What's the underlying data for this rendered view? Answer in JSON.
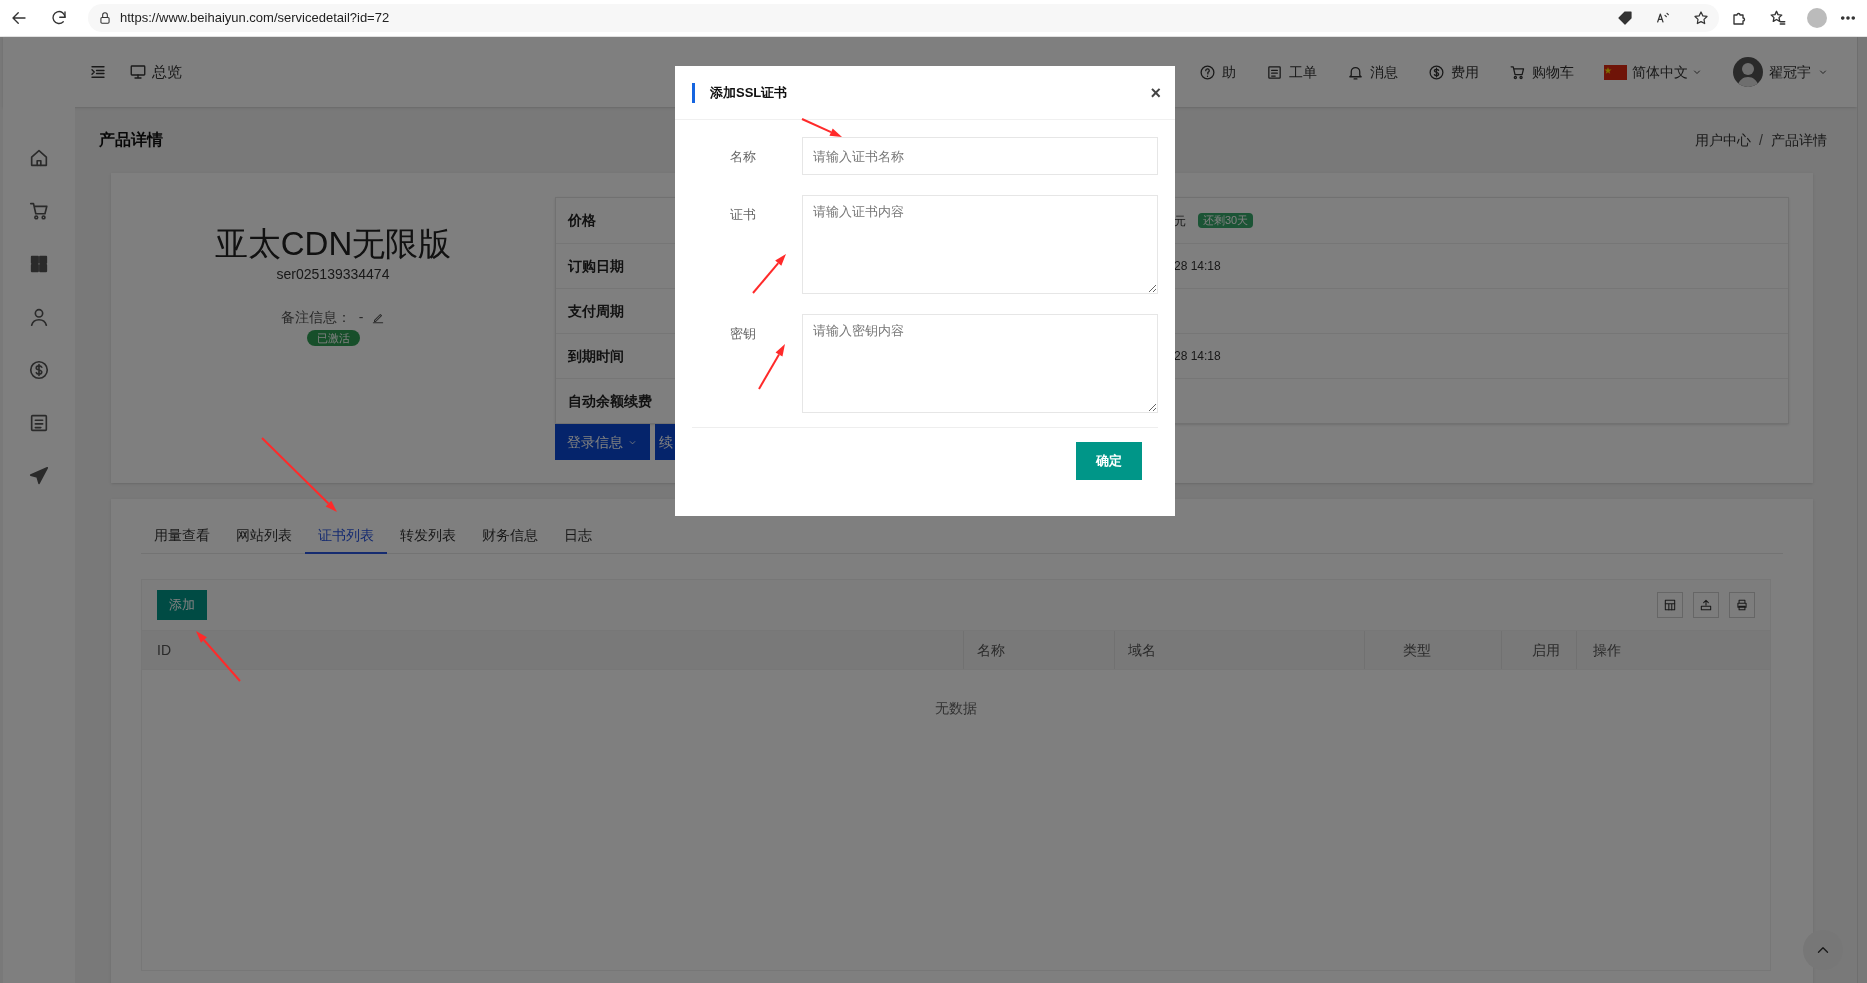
{
  "browser": {
    "url": "https://www.beihaiyun.com/servicedetail?id=72"
  },
  "header": {
    "overview": "总览",
    "right_items": [
      {
        "kind": "help",
        "label": "助"
      },
      {
        "kind": "ticket",
        "label": "工单"
      },
      {
        "kind": "bell",
        "label": "消息"
      },
      {
        "kind": "coin",
        "label": "费用"
      },
      {
        "kind": "cart",
        "label": "购物车"
      }
    ],
    "language": "简体中文",
    "user": "翟冠宇"
  },
  "page": {
    "title": "产品详情",
    "breadcrumb": [
      "用户中心",
      "产品详情"
    ],
    "separator": "/"
  },
  "product": {
    "name": "亚太CDN无限版",
    "id": "ser025139334474",
    "note_label": "备注信息：",
    "note_value": "-",
    "status": "已激活"
  },
  "info_rows": [
    {
      "label": "价格",
      "value": "元",
      "badge": "还剩30天"
    },
    {
      "label": "订购日期",
      "value": "28 14:18"
    },
    {
      "label": "支付周期"
    },
    {
      "label": "到期时间",
      "value": "28 14:18"
    },
    {
      "label": "自动余额续费"
    }
  ],
  "action_buttons": [
    "登录信息",
    "续"
  ],
  "tabs": [
    {
      "label": "用量查看",
      "selected": false
    },
    {
      "label": "网站列表",
      "selected": false
    },
    {
      "label": "证书列表",
      "selected": true
    },
    {
      "label": "转发列表",
      "selected": false
    },
    {
      "label": "财务信息",
      "selected": false
    },
    {
      "label": "日志",
      "selected": false
    }
  ],
  "table": {
    "add_button": "添加",
    "columns": [
      "ID",
      "名称",
      "域名",
      "类型",
      "启用",
      "操作"
    ],
    "empty_text": "无数据"
  },
  "modal": {
    "title": "添加SSL证书",
    "close": "×",
    "fields": [
      {
        "label": "名称",
        "kind": "input",
        "placeholder": "请输入证书名称"
      },
      {
        "label": "证书",
        "kind": "textarea",
        "placeholder": "请输入证书内容"
      },
      {
        "label": "密钥",
        "kind": "textarea",
        "placeholder": "请输入密钥内容"
      }
    ],
    "confirm": "确定"
  }
}
